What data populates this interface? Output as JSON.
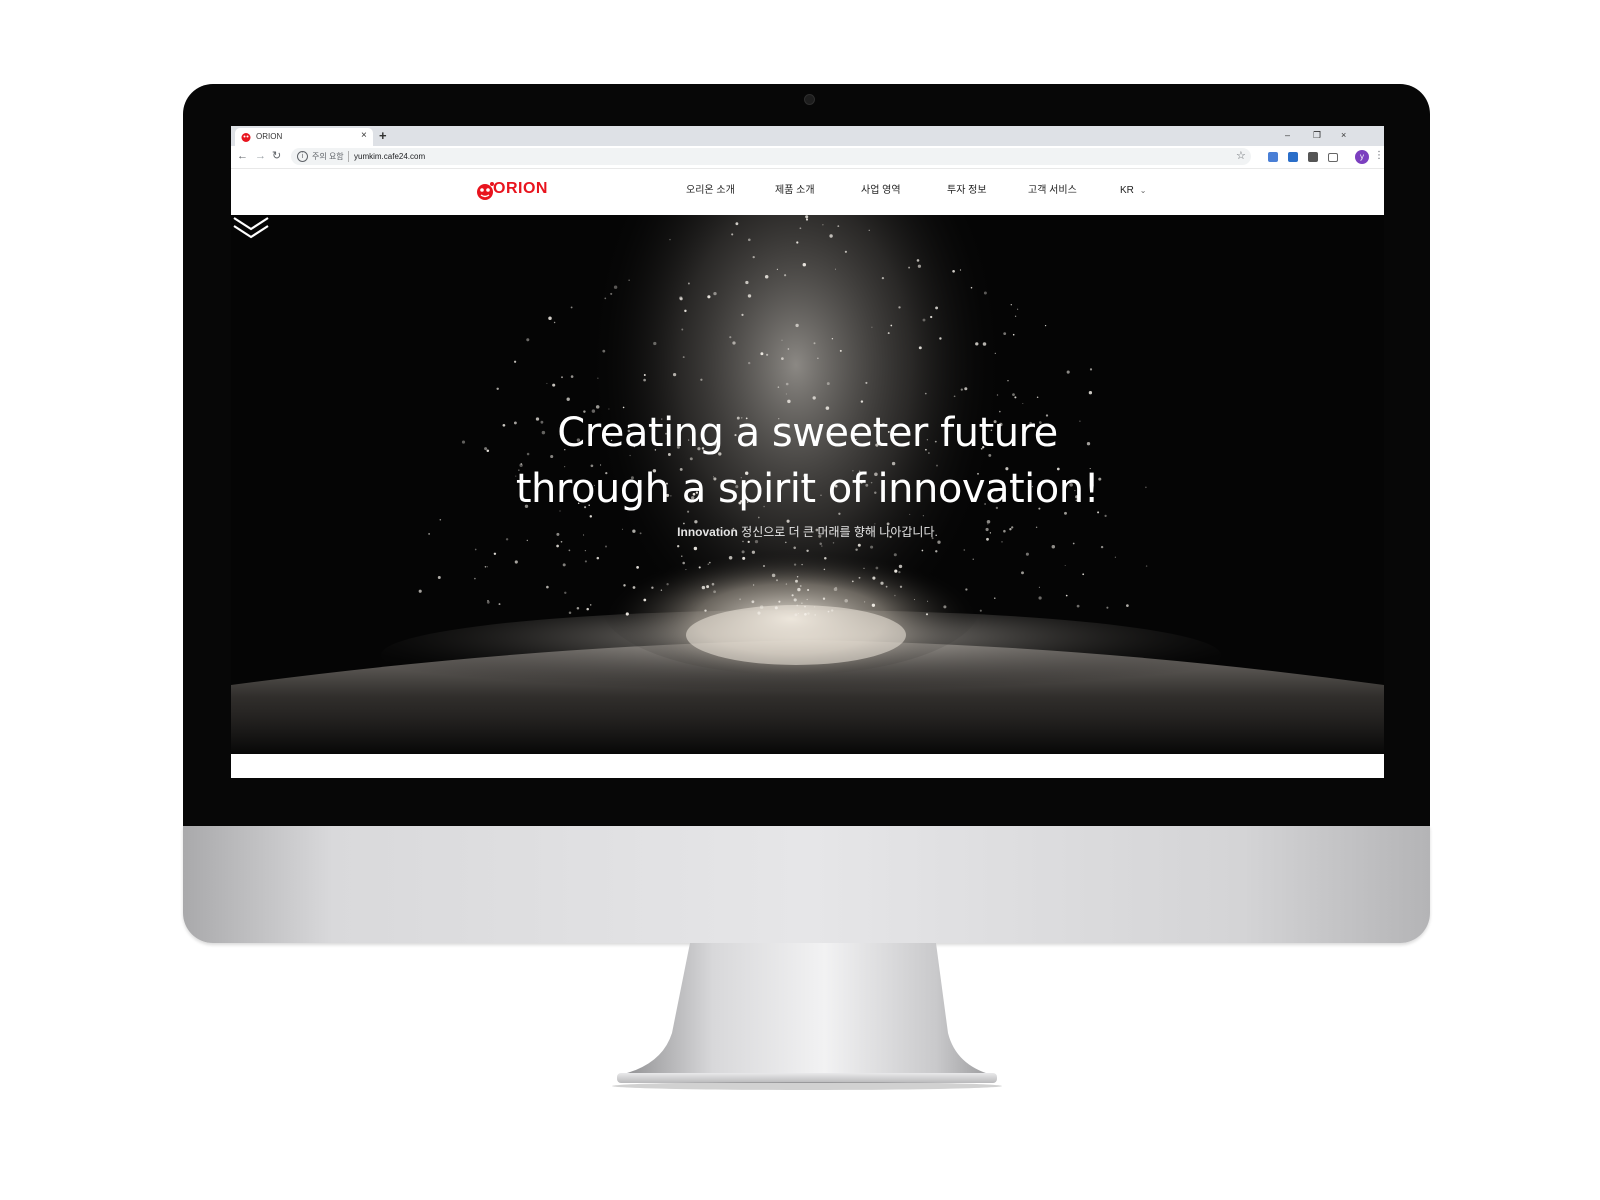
{
  "browser": {
    "tab_title": "ORION",
    "tab_close": "×",
    "new_tab": "+",
    "window_controls": [
      "–",
      "❐",
      "×"
    ],
    "security_label": "주의 요함",
    "url": "yumkim.cafe24.com",
    "avatar_letter": "y",
    "icons": [
      "back-icon",
      "forward-icon",
      "reload-icon",
      "info-icon",
      "star-icon",
      "translate-icon",
      "download-extension-icon",
      "c-extension-icon",
      "camera-icon",
      "menu-icon"
    ]
  },
  "site": {
    "logo_text": "ORION",
    "brand_color": "#e8141e",
    "nav": [
      "오리온 소개",
      "제품 소개",
      "사업 영역",
      "투자 정보",
      "고객 서비스"
    ],
    "language": "KR"
  },
  "hero": {
    "headline_line1": "Creating a sweeter future",
    "headline_line2": "through a spirit of innovation!",
    "subline_strong": "Innovation",
    "subline_rest": " 정신으로 더 큰 미래를 향해 나아갑니다."
  }
}
